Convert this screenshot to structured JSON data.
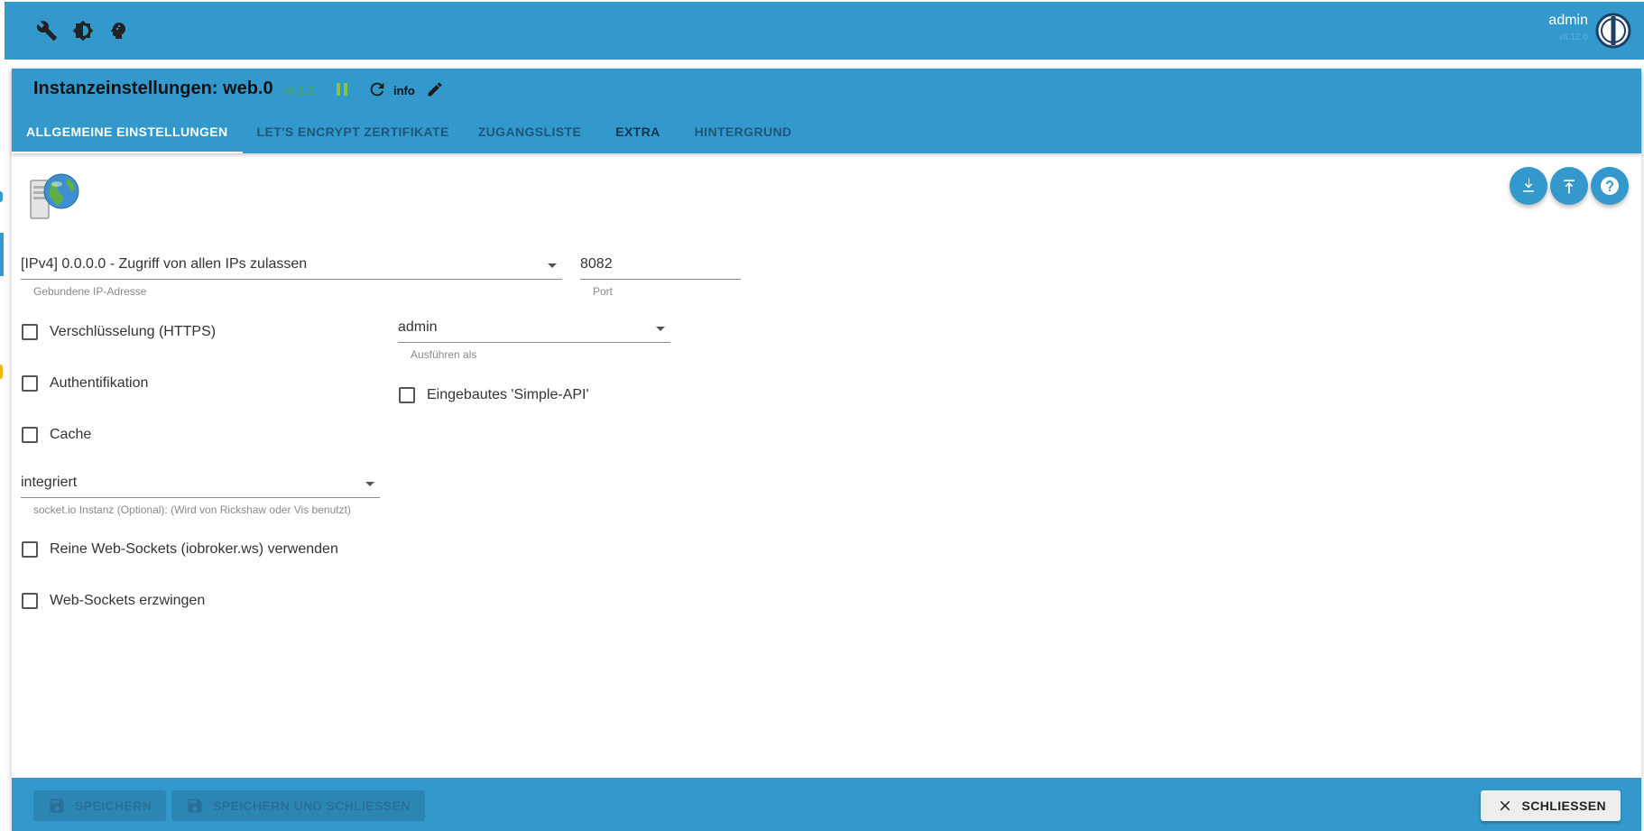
{
  "topbar": {
    "icons": [
      "wrench-icon",
      "brightness-icon",
      "expert-mode-icon"
    ],
    "user": "admin",
    "version": "v6.12.0"
  },
  "dialog": {
    "title": "Instanzeinstellungen: web.0",
    "version": "v6.1.2",
    "info_label": "info",
    "tabs": [
      {
        "label": "ALLGEMEINE EINSTELLUNGEN",
        "active": true
      },
      {
        "label": "LET'S ENCRYPT ZERTIFIKATE",
        "active": false
      },
      {
        "label": "ZUGANGSLISTE",
        "active": false
      },
      {
        "label": "EXTRA",
        "active": false
      },
      {
        "label": "HINTERGRUND",
        "active": false
      }
    ]
  },
  "form": {
    "bind_ip": {
      "value": "[IPv4] 0.0.0.0 - Zugriff von allen IPs zulassen",
      "helper": "Gebundene IP-Adresse"
    },
    "port": {
      "value": "8082",
      "helper": "Port"
    },
    "https": {
      "label": "Verschlüsselung (HTTPS)",
      "checked": false
    },
    "run_as": {
      "value": "admin",
      "helper": "Ausführen als"
    },
    "auth": {
      "label": "Authentifikation",
      "checked": false
    },
    "simple_api": {
      "label": "Eingebautes 'Simple-API'",
      "checked": false
    },
    "cache": {
      "label": "Cache",
      "checked": false
    },
    "socketio": {
      "value": "integriert",
      "helper": "socket.io Instanz (Optional): (Wird von Rickshaw oder Vis benutzt)"
    },
    "pure_ws": {
      "label": "Reine Web-Sockets (iobroker.ws) verwenden",
      "checked": false
    },
    "force_ws": {
      "label": "Web-Sockets erzwingen",
      "checked": false
    }
  },
  "footer": {
    "save": "SPEICHERN",
    "save_close": "SPEICHERN UND SCHLIESSEN",
    "close": "SCHLIESSEN"
  },
  "colors": {
    "primary": "#3399cc",
    "version_green": "#4ea85a",
    "pause_green": "#8bc34a"
  }
}
